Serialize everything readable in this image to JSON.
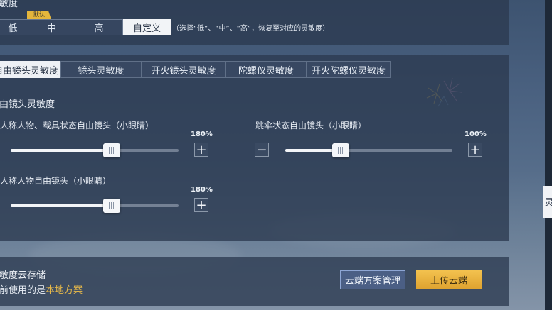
{
  "header": {
    "section_title": "灵敏度"
  },
  "presets": {
    "default_badge": "默认",
    "options": [
      "低",
      "中",
      "高",
      "自定义"
    ],
    "selected": "自定义",
    "hint": "（选择“低”、“中”、“高”，恢复至对应的灵敏度）"
  },
  "tabs": [
    "自由镜头灵敏度",
    "镜头灵敏度",
    "开火镜头灵敏度",
    "陀螺仪灵敏度",
    "开火陀螺仪灵敏度"
  ],
  "active_tab": "自由镜头灵敏度",
  "section": {
    "title": "自由镜头灵敏度"
  },
  "sliders": [
    {
      "label": "三人称人物、载具状态自由镜头（小眼睛）",
      "value_text": "180%",
      "value": 180,
      "fill_fraction": 0.6
    },
    {
      "label": "跳伞状态自由镜头（小眼睛）",
      "value_text": "100%",
      "value": 100,
      "fill_fraction": 0.33
    },
    {
      "label": "一人称人物自由镜头（小眼睛）",
      "value_text": "180%",
      "value": 180,
      "fill_fraction": 0.6
    }
  ],
  "controls": {
    "minus": "−",
    "plus": "+"
  },
  "cloud": {
    "title": "灵敏度云存储",
    "status_prefix": "当前使用的是",
    "status_value": "本地方案",
    "manage_button": "云端方案管理",
    "upload_button": "上传云端"
  },
  "side_tab": {
    "label": "灵"
  },
  "colors": {
    "accent_gold": "#e8b33c",
    "status_gold": "#e6b84a",
    "panel": "#2c3a50"
  }
}
